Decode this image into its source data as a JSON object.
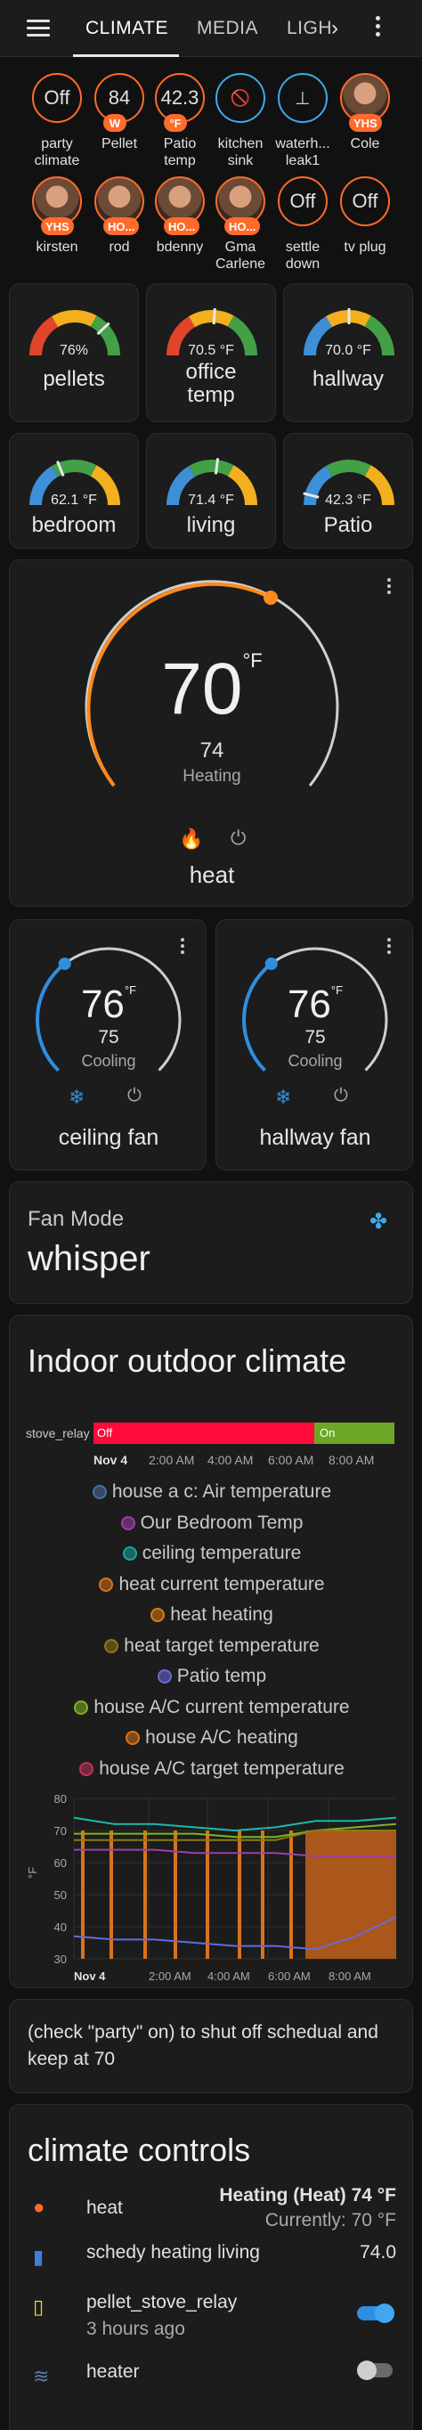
{
  "header": {
    "tabs": [
      "CLIMATE",
      "MEDIA",
      "LIGH"
    ]
  },
  "badges": [
    {
      "value": "Off",
      "label1": "party",
      "label2": "climate",
      "tag": ""
    },
    {
      "value": "84",
      "label1": "Pellet",
      "label2": "",
      "tag": "W"
    },
    {
      "value": "42.3",
      "label1": "Patio",
      "label2": "temp",
      "tag": "°F"
    },
    {
      "value": "",
      "label1": "kitchen",
      "label2": "sink",
      "tag": ""
    },
    {
      "value": "",
      "label1": "waterh...",
      "label2": "leak1",
      "tag": ""
    },
    {
      "value": "",
      "label1": "Cole",
      "label2": "",
      "tag": "YHS"
    },
    {
      "value": "",
      "label1": "kirsten",
      "label2": "",
      "tag": "YHS"
    },
    {
      "value": "",
      "label1": "rod",
      "label2": "",
      "tag": "HO..."
    },
    {
      "value": "",
      "label1": "bdenny",
      "label2": "",
      "tag": "HO..."
    },
    {
      "value": "",
      "label1": "Gma",
      "label2": "Carlene",
      "tag": "HO..."
    },
    {
      "value": "Off",
      "label1": "settle",
      "label2": "down",
      "tag": ""
    },
    {
      "value": "Off",
      "label1": "tv plug",
      "label2": "",
      "tag": ""
    }
  ],
  "gauges": [
    {
      "value": "76%",
      "label": "pellets",
      "level": 0.76
    },
    {
      "value": "70.5 °F",
      "label": "office temp",
      "level": 0.52
    },
    {
      "value": "70.0 °F",
      "label": "hallway",
      "level": 0.5
    },
    {
      "value": "62.1 °F",
      "label": "bedroom",
      "level": 0.38
    },
    {
      "value": "71.4 °F",
      "label": "living",
      "level": 0.54
    },
    {
      "value": "42.3 °F",
      "label": "Patio",
      "level": 0.08
    }
  ],
  "thermostat_main": {
    "target": "70",
    "unit": "°F",
    "current": "74",
    "action": "Heating",
    "name": "heat"
  },
  "thermostat_small": [
    {
      "target": "76",
      "unit": "°F",
      "current": "75",
      "action": "Cooling",
      "name": "ceiling fan"
    },
    {
      "target": "76",
      "unit": "°F",
      "current": "75",
      "action": "Cooling",
      "name": "hallway fan"
    }
  ],
  "fan_mode": {
    "title": "Fan Mode",
    "value": "whisper"
  },
  "history": {
    "title": "Indoor outdoor climate",
    "timeline_label": "stove_relay",
    "timeline_off": "Off",
    "timeline_on": "On",
    "time_labels": [
      "Nov 4",
      "2:00 AM",
      "4:00 AM",
      "6:00 AM",
      "8:00 AM"
    ],
    "legend": [
      {
        "name": "house a c: Air temperature",
        "color": "#4a6fa5"
      },
      {
        "name": "Our Bedroom Temp",
        "color": "#9c3fa8"
      },
      {
        "name": "ceiling temperature",
        "color": "#1aa5a0"
      },
      {
        "name": "heat current temperature",
        "color": "#d9731a"
      },
      {
        "name": "heat heating",
        "color": "#e07a10"
      },
      {
        "name": "heat target temperature",
        "color": "#8a7a12"
      },
      {
        "name": "Patio temp",
        "color": "#6a6ad8"
      },
      {
        "name": "house A/C current temperature",
        "color": "#7fb51f"
      },
      {
        "name": "house A/C heating",
        "color": "#d9731a"
      },
      {
        "name": "house A/C target temperature",
        "color": "#c0335a"
      }
    ]
  },
  "chart_data": {
    "type": "line",
    "ylabel": "°F",
    "ylim": [
      30,
      80
    ],
    "yticks": [
      "80",
      "70",
      "60",
      "50",
      "40",
      "30"
    ],
    "x": [
      "Nov 4",
      "2:00 AM",
      "4:00 AM",
      "6:00 AM",
      "8:00 AM"
    ],
    "series": [
      {
        "name": "ceiling temperature",
        "values": [
          74,
          72,
          72,
          71,
          70,
          71,
          73,
          73,
          74
        ]
      },
      {
        "name": "heat current temperature",
        "values": [
          69,
          69,
          69,
          69,
          68,
          68,
          70,
          71,
          72
        ]
      },
      {
        "name": "heat target temperature",
        "values": [
          67,
          67,
          67,
          67,
          67,
          67,
          70,
          70,
          70
        ]
      },
      {
        "name": "Our Bedroom Temp",
        "values": [
          64,
          64,
          64,
          63,
          63,
          63,
          62,
          62,
          62
        ]
      },
      {
        "name": "Patio temp",
        "values": [
          37,
          36,
          36,
          35,
          34,
          34,
          33,
          37,
          43
        ]
      }
    ]
  },
  "markdown": {
    "text": "(check \"party\" on) to shut off schedual and keep at 70"
  },
  "entities": {
    "title": "climate controls",
    "rows": [
      {
        "name": "heat",
        "state": "Heating (Heat) 74 °F",
        "sub": "Currently: 70 °F",
        "icon": "thermostat-icon",
        "color": "#ff6b2b"
      },
      {
        "name": "schedy heating living",
        "state": "74.0",
        "sub": "",
        "icon": "bookmark-icon",
        "color": "#3d7fd8"
      },
      {
        "name": "pellet_stove_relay",
        "state": "",
        "sub": "3 hours ago",
        "icon": "switch-icon",
        "color": "#f5d33b",
        "toggle": true
      },
      {
        "name": "heater",
        "state": "",
        "sub": "",
        "icon": "heater-icon",
        "color": "#5a7fa8",
        "toggle": false
      }
    ]
  }
}
